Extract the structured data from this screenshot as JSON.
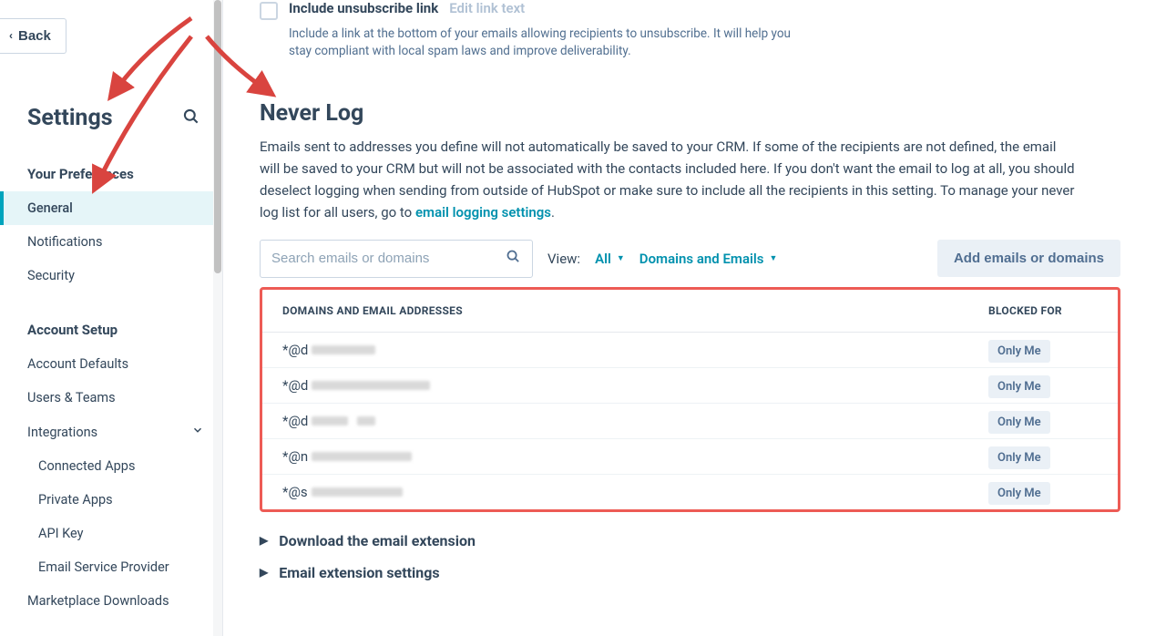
{
  "back_label": "Back",
  "settings_title": "Settings",
  "sidebar": {
    "section1_title": "Your Preferences",
    "item_general": "General",
    "item_notifications": "Notifications",
    "item_security": "Security",
    "section2_title": "Account Setup",
    "item_account_defaults": "Account Defaults",
    "item_users_teams": "Users & Teams",
    "item_integrations": "Integrations",
    "item_connected_apps": "Connected Apps",
    "item_private_apps": "Private Apps",
    "item_api_key": "API Key",
    "item_esp": "Email Service Provider",
    "item_marketplace_downloads": "Marketplace Downloads"
  },
  "unsub": {
    "title": "Include unsubscribe link",
    "edit": "Edit link text",
    "help": "Include a link at the bottom of your emails allowing recipients to unsubscribe. It will help you stay compliant with local spam laws and improve deliverability."
  },
  "neverlog": {
    "heading": "Never Log",
    "desc_a": "Emails sent to addresses you define will not automatically be saved to your CRM. If some of the recipients are not defined, the email will be saved to your CRM but will not be associated with the contacts included here. If you don't want the email to log at all, you should deselect logging when sending from outside of HubSpot or make sure to include all the recipients in this setting. To manage your never log list for all users, go to ",
    "link": "email logging settings",
    "desc_b": "."
  },
  "search_placeholder": "Search emails or domains",
  "view_label": "View:",
  "filter_all": "All",
  "filter_domains": "Domains and Emails",
  "add_button": "Add emails or domains",
  "table": {
    "col1": "DOMAINS AND EMAIL ADDRESSES",
    "col2": "BLOCKED FOR",
    "rows": [
      {
        "prefix": "*@d",
        "badge": "Only Me"
      },
      {
        "prefix": "*@d",
        "badge": "Only Me"
      },
      {
        "prefix": "*@d",
        "badge": "Only Me"
      },
      {
        "prefix": "*@n",
        "badge": "Only Me"
      },
      {
        "prefix": "*@s",
        "badge": "Only Me"
      }
    ]
  },
  "expander1": "Download the email extension",
  "expander2": "Email extension settings"
}
